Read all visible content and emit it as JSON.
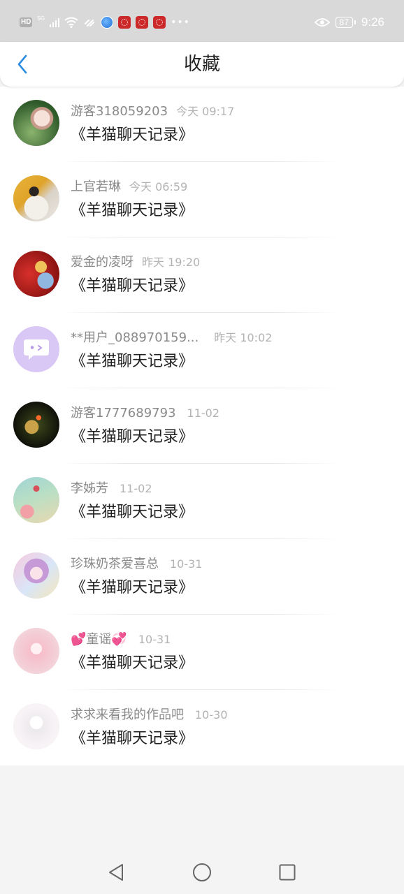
{
  "status_bar": {
    "hd": "HD",
    "network": "5G",
    "battery": "87",
    "time": "9:26",
    "icons": [
      "signal-icon",
      "wifi-icon",
      "link-icon",
      "globe-icon",
      "red-app-icon",
      "red-app-icon",
      "red-app-icon",
      "more-icon",
      "eye-icon"
    ]
  },
  "header": {
    "title": "收藏",
    "back_icon": "chevron-left-icon",
    "accent": "#2a8de0"
  },
  "favorites": [
    {
      "name": "游客318059203",
      "time": "今天 09:17",
      "message": "《羊猫聊天记录》"
    },
    {
      "name": "上官若琳",
      "time": "今天 06:59",
      "message": "《羊猫聊天记录》"
    },
    {
      "name": "爱金的凌呀",
      "time": "昨天 19:20",
      "message": "《羊猫聊天记录》"
    },
    {
      "name": "**用户_088970159...",
      "time": "昨天 10:02",
      "message": "《羊猫聊天记录》"
    },
    {
      "name": "游客1777689793",
      "time": "11-02",
      "message": "《羊猫聊天记录》"
    },
    {
      "name": "李姊芳",
      "time": "11-02",
      "message": "《羊猫聊天记录》"
    },
    {
      "name": "珍珠奶茶爱喜总",
      "time": "10-31",
      "message": "《羊猫聊天记录》"
    },
    {
      "name": "💕童谣💞",
      "time": "10-31",
      "message": "《羊猫聊天记录》"
    },
    {
      "name": "求求来看我的作品吧",
      "time": "10-30",
      "message": "《羊猫聊天记录》"
    }
  ],
  "nav": {
    "icons": [
      "back-triangle-icon",
      "home-circle-icon",
      "recents-square-icon"
    ]
  }
}
